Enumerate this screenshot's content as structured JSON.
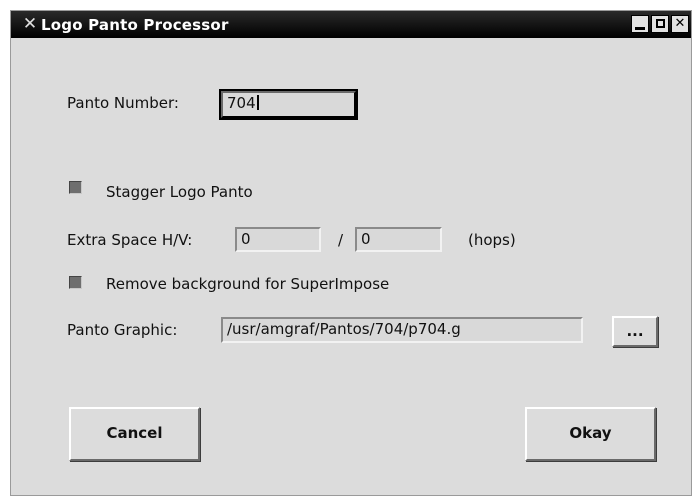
{
  "window": {
    "title": "Logo Panto Processor",
    "app_icon_glyph": "✕",
    "icons": [
      "x-logo-icon",
      "minimize-icon",
      "maximize-icon",
      "close-icon"
    ],
    "close_glyph": "✕"
  },
  "form": {
    "panto_number_label": "Panto Number:",
    "panto_number_value": "704",
    "stagger_label": "Stagger Logo Panto",
    "stagger_checked": true,
    "extra_space_label": "Extra Space H/V:",
    "extra_space_h": "0",
    "separator": "/",
    "extra_space_v": "0",
    "hops_label": "(hops)",
    "remove_bg_label": "Remove background for SuperImpose",
    "remove_bg_checked": true,
    "panto_graphic_label": "Panto Graphic:",
    "panto_graphic_value": "/usr/amgraf/Pantos/704/p704.g",
    "browse_label": "..."
  },
  "buttons": {
    "cancel": "Cancel",
    "okay": "Okay"
  }
}
